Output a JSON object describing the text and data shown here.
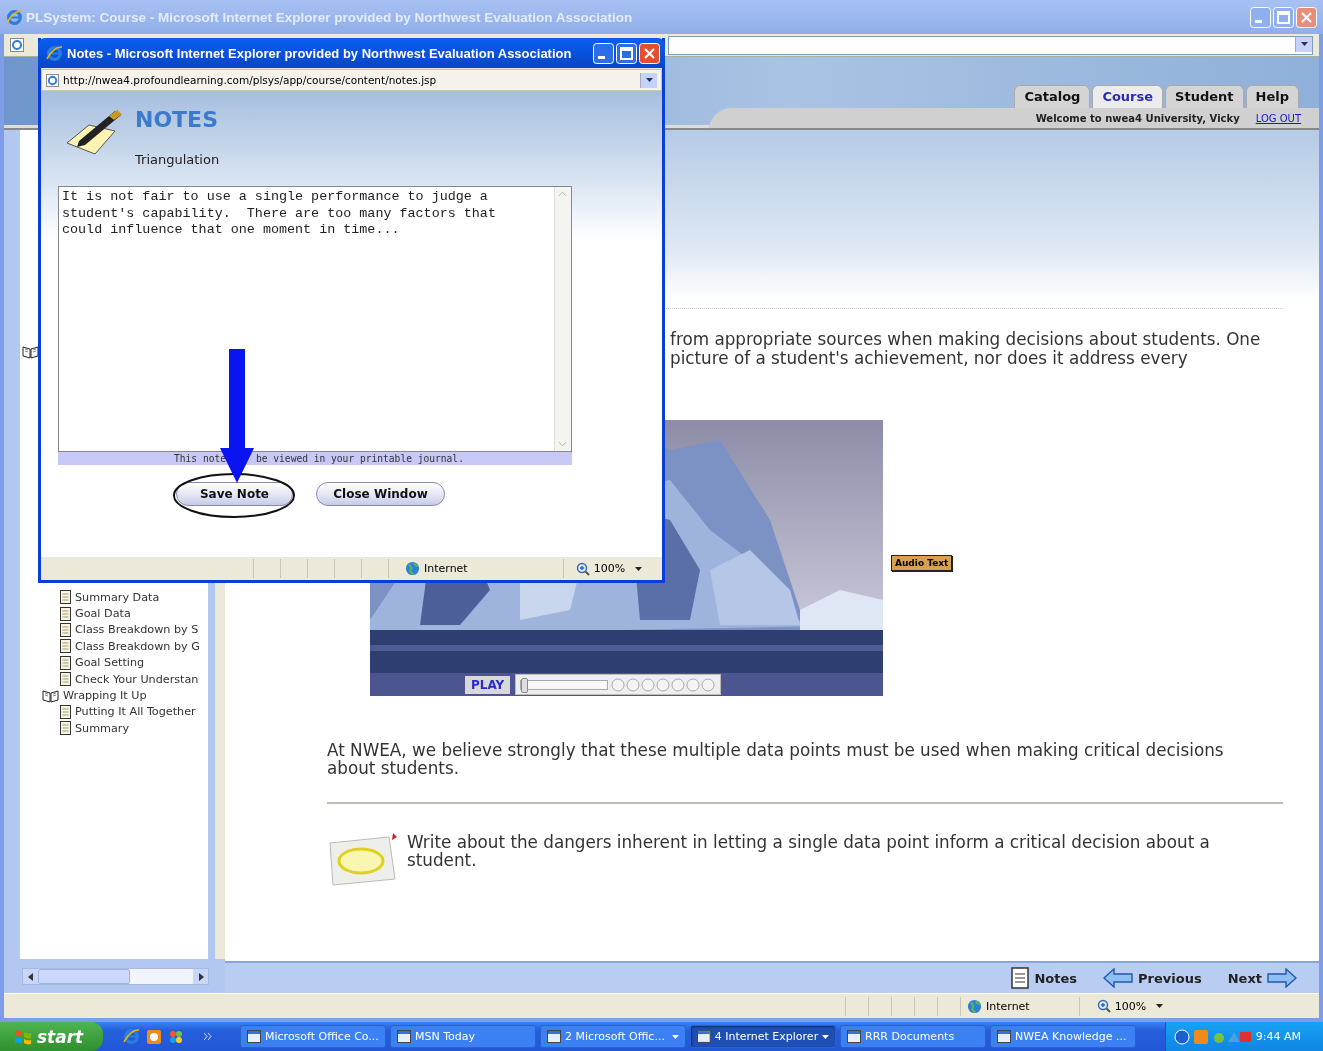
{
  "window": {
    "title": "PLSystem: Course - Microsoft Internet Explorer provided by Northwest Evaluation Association"
  },
  "tabs": [
    {
      "label": "Catalog",
      "selected": false
    },
    {
      "label": "Course",
      "selected": true
    },
    {
      "label": "Student",
      "selected": false
    },
    {
      "label": "Help",
      "selected": false
    }
  ],
  "welcome": "Welcome to nwea4 University, Vicky",
  "logout": "LOG OUT",
  "sidebar": {
    "pages": [
      {
        "label": "Summary Data"
      },
      {
        "label": "Goal Data"
      },
      {
        "label": "Class Breakdown by S"
      },
      {
        "label": "Class Breakdown by G"
      },
      {
        "label": "Goal Setting"
      },
      {
        "label": "Check Your Understan"
      }
    ],
    "sections": [
      {
        "label": "Wrapping It Up",
        "children": [
          {
            "label": "Putting It All Together"
          },
          {
            "label": "Summary"
          }
        ]
      }
    ]
  },
  "content": {
    "paragraph_fragments": [
      "from appropriate sources when making decisions about students. One",
      "picture of a student's achievement, nor does it address every"
    ],
    "video": {
      "play": "PLAY",
      "seek": {
        "level": 0
      }
    },
    "audio_button": "Audio Text",
    "paragraph": "At NWEA, we believe strongly that these multiple data points must be used when making critical decisions about students.",
    "journal_prompt": "Write about the dangers inherent in letting a single data point inform a critical decision about a student."
  },
  "nav": [
    {
      "label": "Notes",
      "kind": "notes"
    },
    {
      "label": "Previous",
      "kind": "previous"
    },
    {
      "label": "Next",
      "kind": "next"
    }
  ],
  "status_bar": {
    "zone": "Internet",
    "zoom": "100%"
  },
  "notes_window": {
    "title": "Notes - Microsoft Internet Explorer provided by Northwest Evaluation Association",
    "address": "http://nwea4.profoundlearning.com/plsys/app/course/content/notes.jsp",
    "heading": "NOTES",
    "topic": "Triangulation",
    "note_text": "It is not fair to use a single performance to judge a student's capability.  There are too many factors that could influence that one moment in time...",
    "hint": [
      "This note",
      "be viewed in your printable journal."
    ],
    "buttons": [
      "Save Note",
      "Close Window"
    ],
    "status": {
      "zone": "Internet",
      "zoom": "100%"
    }
  },
  "taskbar": {
    "start": "start",
    "tasks": [
      {
        "label": "Microsoft Office Co...",
        "selected": false,
        "grouped": false
      },
      {
        "label": "MSN Today",
        "selected": false,
        "grouped": false
      },
      {
        "label": "2 Microsoft Offic...",
        "selected": false,
        "grouped": true
      },
      {
        "label": "4 Internet Explorer",
        "selected": true,
        "grouped": true
      },
      {
        "label": "RRR Documents",
        "selected": false,
        "grouped": false
      },
      {
        "label": "NWEA Knowledge ...",
        "selected": false,
        "grouped": false
      }
    ],
    "clock": "9:44 AM"
  }
}
